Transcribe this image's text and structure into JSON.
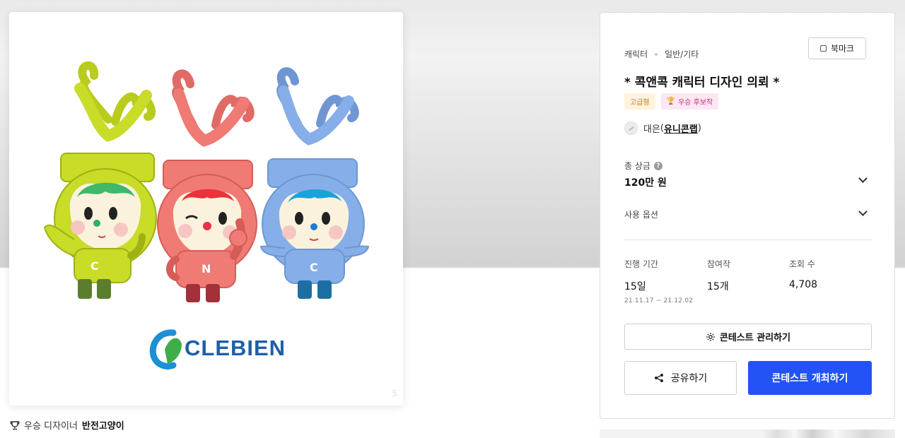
{
  "hero": {
    "brand": "CLEBIEN",
    "character_letters": [
      "C",
      "N",
      "C"
    ],
    "slide_count": "5"
  },
  "winner": {
    "label": "우승 디자이너",
    "name": "반전고양이"
  },
  "contest": {
    "category": "캐릭터",
    "subcategory": "일반/기타",
    "bookmark_label": "북마크",
    "title": "* 콕앤콕 캐릭터 디자인 의뢰 *",
    "badges": {
      "premium": "고급형",
      "candidate": "우승 후보작"
    },
    "host_prefix": "대은",
    "host_name": "유니콘랩"
  },
  "prize": {
    "label": "총 상금",
    "value": "120만 원"
  },
  "options": {
    "label": "사용 옵션"
  },
  "stats": {
    "period_label": "진행 기간",
    "period_value": "15일",
    "period_range": "21.11.17 ~ 21.12.02",
    "entries_label": "참여작",
    "entries_value": "15개",
    "views_label": "조회 수",
    "views_value": "4,708"
  },
  "actions": {
    "manage": "콘테스트 관리하기",
    "share": "공유하기",
    "host": "콘테스트 개최하기"
  },
  "colors": {
    "primary": "#2353f6",
    "char_green": "#c8dc28",
    "char_red": "#f07a74",
    "char_blue": "#86aee8"
  }
}
